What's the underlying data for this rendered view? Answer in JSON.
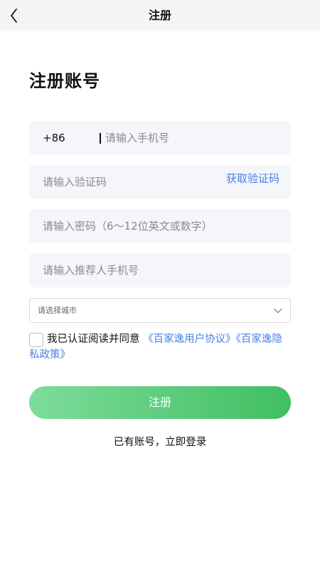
{
  "nav": {
    "title": "注册",
    "back_icon": "chevron-left-icon"
  },
  "page": {
    "heading": "注册账号"
  },
  "form": {
    "phone": {
      "prefix": "+86",
      "placeholder": "请输入手机号",
      "value": ""
    },
    "code": {
      "placeholder": "请输入验证码",
      "value": "",
      "get_code_label": "获取验证码"
    },
    "password": {
      "placeholder": "请输入密码（6～12位英文或数字）",
      "value": ""
    },
    "referrer": {
      "placeholder": "请输入推荐人手机号",
      "value": ""
    },
    "city": {
      "placeholder": "请选择城市",
      "icon": "chevron-down-icon"
    }
  },
  "agreement": {
    "prefix": "我已认证阅读并同意",
    "user_agreement": "《百家逸用户协议》",
    "privacy_policy": "《百家逸隐私政策》",
    "checked": false
  },
  "actions": {
    "submit_label": "注册",
    "login_link": "已有账号，立即登录"
  },
  "colors": {
    "accent_link": "#4a7fe8",
    "button_start": "#7ddc9a",
    "button_end": "#40bf62",
    "field_bg": "#f5f6fa"
  }
}
